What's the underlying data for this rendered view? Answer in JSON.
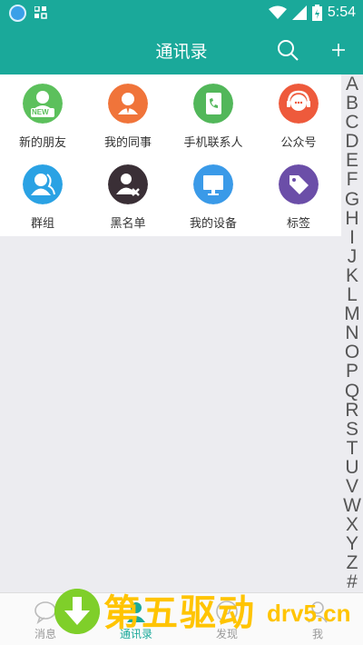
{
  "status": {
    "time": "5:54"
  },
  "header": {
    "title": "通讯录"
  },
  "contacts_grid": [
    {
      "label": "新的朋友",
      "icon": "new-friend-icon",
      "color": "#5cc05c",
      "badge": "NEW"
    },
    {
      "label": "我的同事",
      "icon": "colleague-icon",
      "color": "#f0743a"
    },
    {
      "label": "手机联系人",
      "icon": "phone-contacts-icon",
      "color": "#52b75a"
    },
    {
      "label": "公众号",
      "icon": "public-account-icon",
      "color": "#ee5a3c"
    },
    {
      "label": "群组",
      "icon": "group-icon",
      "color": "#2aa2e4"
    },
    {
      "label": "黑名单",
      "icon": "blacklist-icon",
      "color": "#3a2f36"
    },
    {
      "label": "我的设备",
      "icon": "device-icon",
      "color": "#3a9ae8"
    },
    {
      "label": "标签",
      "icon": "tag-icon",
      "color": "#6b4ea8"
    }
  ],
  "index_letters": [
    "A",
    "B",
    "C",
    "D",
    "E",
    "F",
    "G",
    "H",
    "I",
    "J",
    "K",
    "L",
    "M",
    "N",
    "O",
    "P",
    "Q",
    "R",
    "S",
    "T",
    "U",
    "V",
    "W",
    "X",
    "Y",
    "Z",
    "#"
  ],
  "tabs": [
    {
      "label": "消息",
      "icon": "chat-icon"
    },
    {
      "label": "通讯录",
      "icon": "contacts-icon",
      "active": true
    },
    {
      "label": "发现",
      "icon": "discover-icon"
    },
    {
      "label": "我",
      "icon": "me-icon"
    }
  ],
  "watermark": {
    "text": "第五驱动",
    "domain": "drv5.cn"
  },
  "colors": {
    "primary": "#1aa99a",
    "background": "#ececf0"
  }
}
